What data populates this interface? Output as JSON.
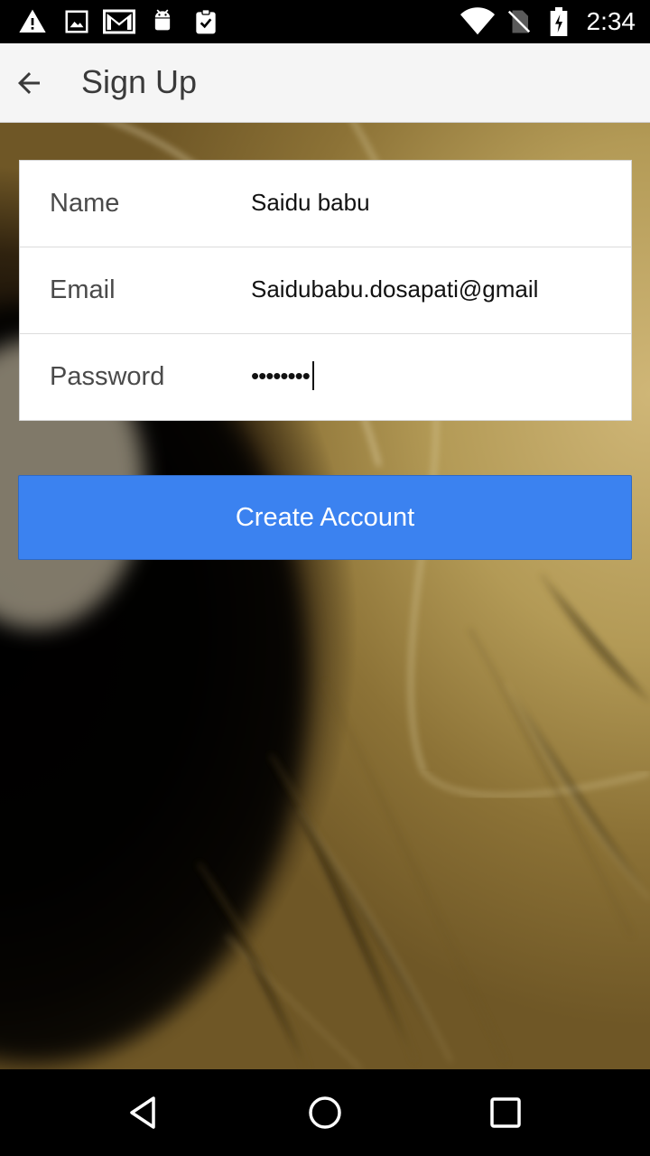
{
  "status_bar": {
    "time": "2:34",
    "icons": [
      "warning-icon",
      "image-icon",
      "gmail-icon",
      "android-icon",
      "clipboard-check-icon",
      "wifi-icon",
      "no-sim-icon",
      "battery-charging-icon"
    ]
  },
  "app_bar": {
    "title": "Sign Up",
    "back_icon": "arrow-back-icon"
  },
  "form": {
    "fields": [
      {
        "label": "Name",
        "value": "Saidu babu"
      },
      {
        "label": "Email",
        "value": "Saidubabu.dosapati@gmail"
      },
      {
        "label": "Password",
        "value": "••••••••"
      }
    ]
  },
  "actions": {
    "create_account_label": "Create Account"
  },
  "nav_bar": {
    "icons": [
      "back-triangle-icon",
      "home-circle-icon",
      "recents-square-icon"
    ]
  },
  "colors": {
    "primary_button": "#3b82f0",
    "app_bar": "#f5f5f5",
    "status_bar": "#000000"
  }
}
